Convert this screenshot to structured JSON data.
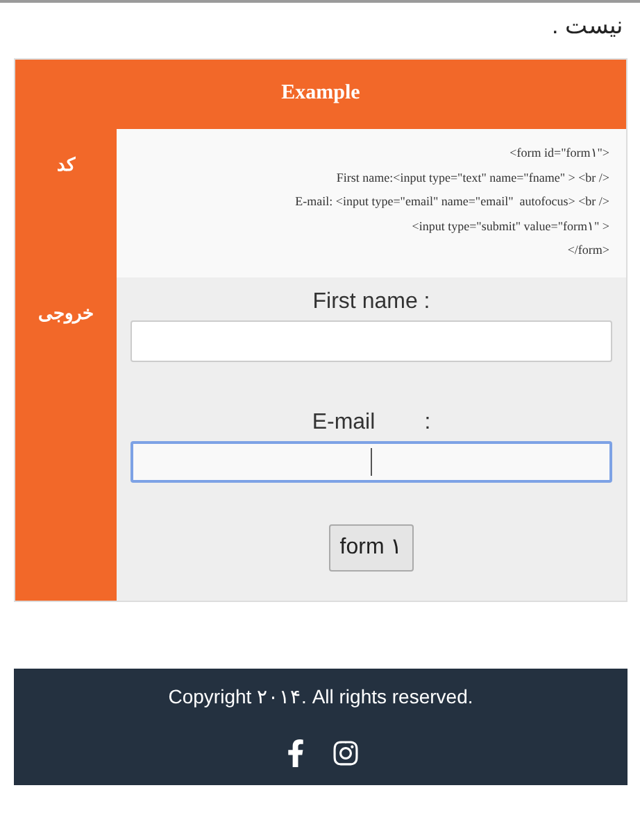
{
  "intro_text": "نیست .",
  "example": {
    "title": "Example",
    "code": {
      "label": "کد",
      "lines": [
        "<form id=\"form١\">",
        "First name:<input type=\"text\" name=\"fname\" > <br />",
        "E-mail: <input type=\"email\" name=\"email\"  autofocus> <br />",
        "<input type=\"submit\" value=\"form١\" >",
        "</form>"
      ]
    },
    "output": {
      "label": "خروجی",
      "fields": [
        {
          "label": "First name :",
          "focused": false
        },
        {
          "label": "E-mail        :",
          "focused": true
        }
      ],
      "submit_button": "form ١"
    }
  },
  "footer": {
    "copyright": "Copyright ۲۰۱۴. All rights reserved.",
    "social": [
      {
        "kind": "facebook"
      },
      {
        "kind": "instagram"
      }
    ]
  }
}
